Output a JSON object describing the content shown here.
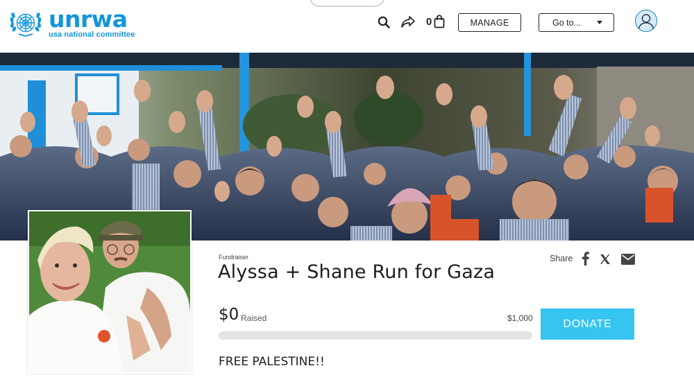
{
  "header": {
    "logo_word": "unrwa",
    "logo_sub": "usa national committee",
    "cart_count": "0",
    "manage_label": "MANAGE",
    "goto_label": "Go to...",
    "icons": [
      "un-emblem-icon",
      "search-icon",
      "share-arrow-icon",
      "shopping-bag-icon",
      "user-avatar-icon",
      "chevron-down-icon"
    ]
  },
  "campaign": {
    "kicker": "Fundraiser",
    "title": "Alyssa + Shane Run for Gaza",
    "raised_amount": "$0",
    "raised_label": "Raised",
    "goal": "$1,000",
    "progress_fraction": 0,
    "donate_label": "DONATE",
    "tagline": "FREE PALESTINE!!"
  },
  "share": {
    "label": "Share",
    "icons": [
      "facebook-icon",
      "x-icon",
      "email-icon"
    ]
  },
  "colors": {
    "brand_blue": "#1296db",
    "donate_button": "#36c4f0",
    "progress_track": "#e4e4e4",
    "text_dark": "#1d1d1d"
  }
}
